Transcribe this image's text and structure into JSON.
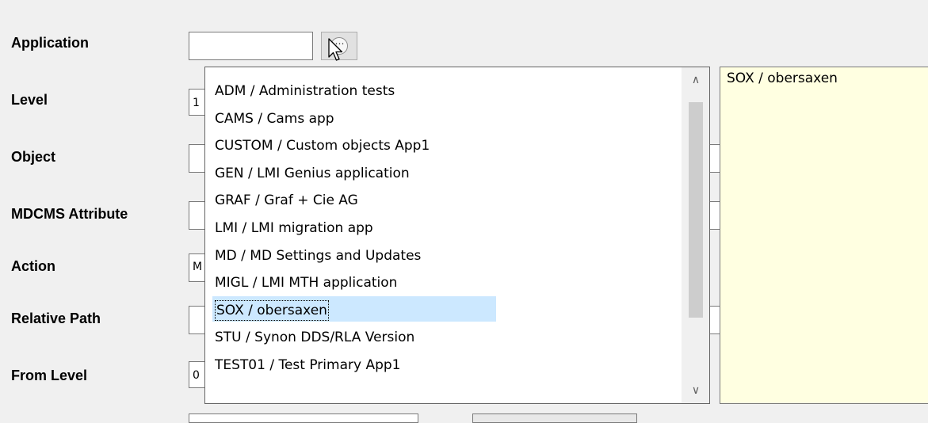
{
  "form": {
    "labels": {
      "application": "Application",
      "level": "Level",
      "object": "Object",
      "mdcms_attribute": "MDCMS Attribute",
      "action": "Action",
      "relative_path": "Relative Path",
      "from_level": "From Level"
    },
    "values": {
      "application": "",
      "level_partial": "1",
      "action_partial": "M",
      "from_level_partial": "0"
    }
  },
  "lookup_button": {
    "glyph": "⋯",
    "icon": "ellipsis-circle-icon"
  },
  "dropdown": {
    "items": [
      "ADM / Administration tests",
      "CAMS / Cams app",
      "CUSTOM / Custom objects App1",
      "GEN / LMI Genius application",
      "GRAF / Graf + Cie AG",
      "LMI / LMI migration app",
      "MD / MD Settings and Updates",
      "MIGL / LMI MTH application",
      "SOX / obersaxen",
      "STU / Synon DDS/RLA Version",
      "TEST01 / Test Primary App1"
    ],
    "selected_index": 8,
    "scroll_up_glyph": "∧",
    "scroll_down_glyph": "∨"
  },
  "notes": {
    "text": "SOX / obersaxen"
  },
  "colors": {
    "window_bg": "#f0f0f0",
    "selection": "#cce8ff",
    "notes_bg": "#ffffe1"
  }
}
